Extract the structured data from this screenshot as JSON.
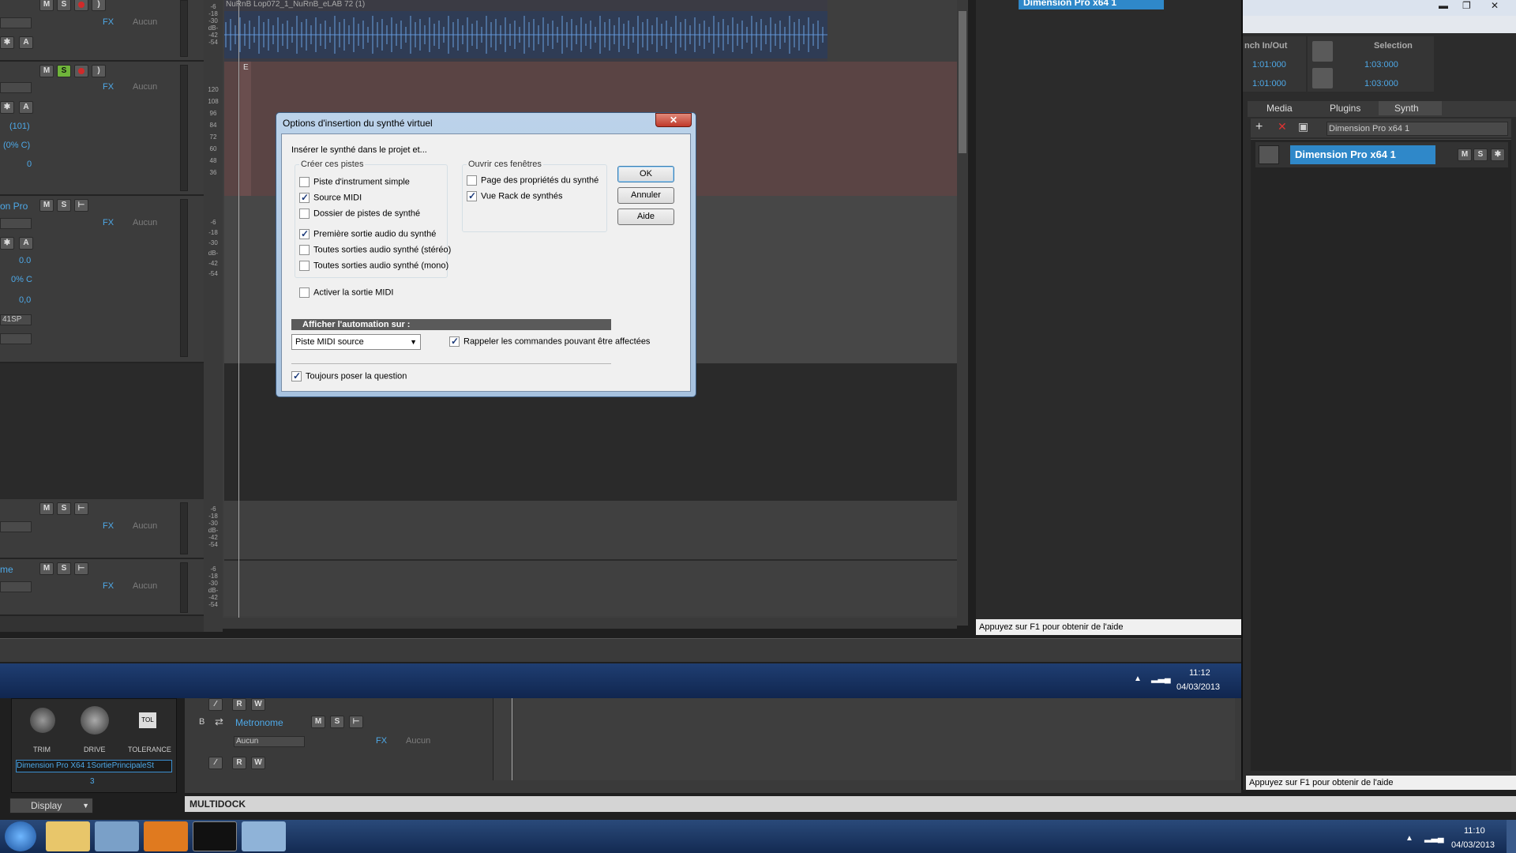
{
  "tracks": {
    "t1": {
      "fx": "FX",
      "input": "Aucun",
      "clip": "NuRnB Lop072_1_NuRnB_eLAB 72 (1)"
    },
    "t2": {
      "fx": "FX",
      "input": "Aucun",
      "vol": "(101)",
      "pan": "(0% C)",
      "val": "0",
      "clip_label": "E"
    },
    "t3": {
      "name": "on Pro",
      "fx": "FX",
      "input": "Aucun",
      "vol": "0.0",
      "pan": "0% C",
      "val": "0,0",
      "out": "41SP"
    },
    "t4": {
      "fx": "FX",
      "input": "Aucun"
    },
    "t5": {
      "name": "me",
      "fx": "FX",
      "input": "Aucun"
    },
    "db": [
      "-6",
      "-18",
      "-30",
      "dB-",
      "-42",
      "-54"
    ],
    "midi_scale": [
      "120",
      "108",
      "96",
      "84",
      "72",
      "60",
      "48",
      "36"
    ]
  },
  "dialog": {
    "title": "Options d'insertion du synthé virtuel",
    "intro": "Insérer le synthé dans le projet et...",
    "create_group": "Créer ces pistes",
    "open_group": "Ouvrir ces fenêtres",
    "create_items": [
      {
        "label": "Piste d'instrument simple",
        "checked": false
      },
      {
        "label": "Source MIDI",
        "checked": true
      },
      {
        "label": "Dossier de pistes de synthé",
        "checked": false
      },
      {
        "label": "Première sortie audio du synthé",
        "checked": true
      },
      {
        "label": "Toutes sorties audio synthé (stéréo)",
        "checked": false
      },
      {
        "label": "Toutes sorties audio synthé (mono)",
        "checked": false
      }
    ],
    "open_items": [
      {
        "label": "Page des propriétés du synthé",
        "checked": false
      },
      {
        "label": "Vue Rack de synthés",
        "checked": true
      }
    ],
    "midi_out": {
      "label": "Activer la sortie MIDI",
      "checked": false
    },
    "automation_header": "Afficher l'automation sur :",
    "automation_select": "Piste MIDI source",
    "recall": {
      "label": "Rappeler les commandes pouvant être affectées",
      "checked": true
    },
    "always_ask": {
      "label": "Toujours poser la question",
      "checked": true
    },
    "ok": "OK",
    "cancel": "Annuler",
    "help": "Aide",
    "close": "✕"
  },
  "synth_rack_top": {
    "name": "Dimension Pro x64 1"
  },
  "right_panel": {
    "punch_label": "nch In/Out",
    "punch_in": "1:01:000",
    "punch_out": "1:01:000",
    "selection_label": "Selection",
    "sel_start": "1:03:000",
    "sel_end": "1:03:000",
    "tabs": [
      "Media",
      "Plugins",
      "Synth"
    ],
    "synth_select": "Dimension Pro x64 1",
    "synth_name": "Dimension Pro x64 1",
    "status": "Appuyez sur F1 pour obtenir de l'aide"
  },
  "center_status": "Appuyez sur F1 pour obtenir de l'aide",
  "inner_taskbar": {
    "time": "11:12",
    "date": "04/03/2013"
  },
  "bottom": {
    "knobs": [
      "TRIM",
      "DRIVE",
      "TOLERANCE"
    ],
    "tol_button": "TOL",
    "plugin_name": "Dimension Pro X64 1SortiePrincipaleSt",
    "plugin_num": "3",
    "display": "Display",
    "track_letter": "B",
    "metronome": "Metronome",
    "met_input": "Aucun",
    "fx": "FX",
    "input": "Aucun",
    "multidock": "MULTIDOCK"
  },
  "taskbar": {
    "time": "11:10",
    "date": "04/03/2013"
  }
}
